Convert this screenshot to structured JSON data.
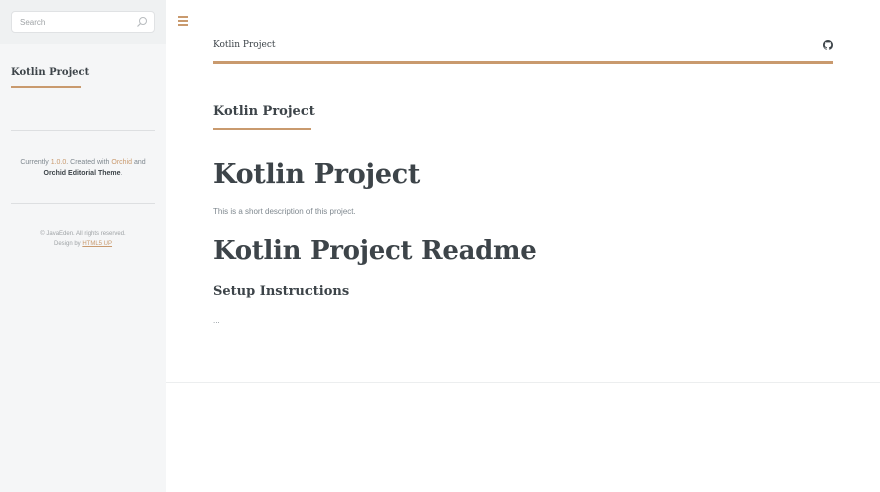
{
  "search": {
    "placeholder": "Search"
  },
  "sidebar": {
    "title": "Kotlin Project",
    "credit": {
      "currently": "Currently",
      "version": "1.0.0",
      "created_with": ". Created with",
      "orchid": "Orchid",
      "and": "and",
      "theme": "Orchid Editorial Theme",
      "period": "."
    },
    "copyright": "© JavaEden. All rights reserved.",
    "design_by": "Design by",
    "design_link": "HTML5 UP"
  },
  "header": {
    "title": "Kotlin Project"
  },
  "main": {
    "section_title": "Kotlin Project",
    "heading": "Kotlin Project",
    "description": "This is a short description of this project.",
    "readme_heading": "Kotlin Project Readme",
    "subheading": "Setup Instructions",
    "body": "..."
  },
  "colors": {
    "accent": "#c99a6e",
    "text": "#3d4449",
    "muted": "#7f888f",
    "sidebar_bg": "#f5f6f7"
  },
  "icons": {
    "search": "search-icon",
    "menu": "hamburger-menu-icon",
    "github": "github-icon"
  }
}
